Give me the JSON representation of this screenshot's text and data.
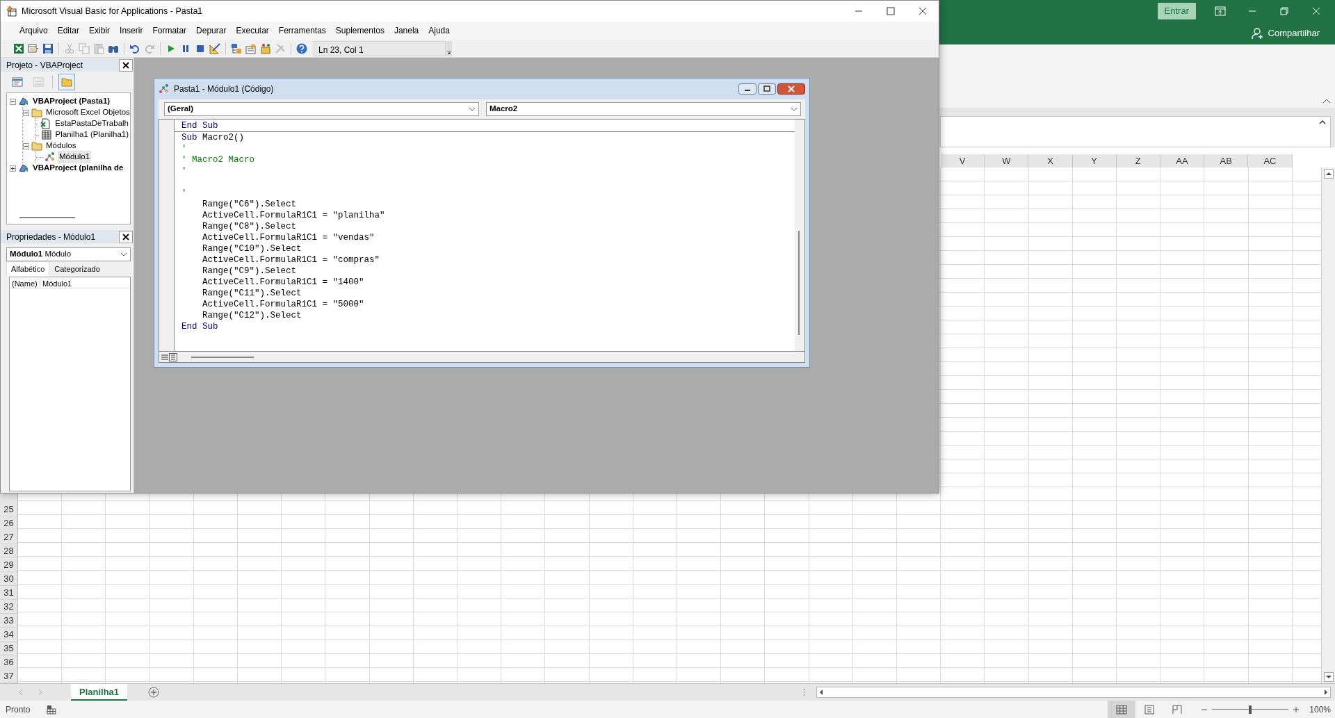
{
  "excel": {
    "sign_in_button": "Entrar",
    "share_button": "Compartilhar",
    "column_headers": [
      "V",
      "W",
      "X",
      "Y",
      "Z",
      "AA",
      "AB",
      "AC"
    ],
    "row_headers": [
      "25",
      "26",
      "27",
      "28",
      "29",
      "30",
      "31",
      "32",
      "33",
      "34",
      "35",
      "36",
      "37"
    ],
    "sheet_tabs": [
      {
        "label": "Planilha1",
        "selected": true
      }
    ],
    "status_bar": {
      "status": "Pronto",
      "views": [
        {
          "kind": "normal",
          "selected": true
        },
        {
          "kind": "page-layout",
          "selected": false
        },
        {
          "kind": "page-break",
          "selected": false
        }
      ],
      "zoom": {
        "level": 0.5,
        "reading": "100%"
      }
    }
  },
  "vba": {
    "title": "Microsoft Visual Basic for Applications - Pasta1",
    "menu": [
      "Arquivo",
      "Editar",
      "Exibir",
      "Inserir",
      "Formatar",
      "Depurar",
      "Executar",
      "Ferramentas",
      "Suplementos",
      "Janela",
      "Ajuda"
    ],
    "toolbar": {
      "buttons": [
        {
          "kind": "excel",
          "disabled": false
        },
        {
          "kind": "insert",
          "disabled": false
        },
        {
          "kind": "save",
          "disabled": false
        },
        {
          "kind": "sep",
          "disabled": false
        },
        {
          "kind": "cut",
          "disabled": true
        },
        {
          "kind": "copy",
          "disabled": true
        },
        {
          "kind": "paste",
          "disabled": true
        },
        {
          "kind": "find",
          "disabled": false
        },
        {
          "kind": "sep",
          "disabled": false
        },
        {
          "kind": "undo",
          "disabled": false
        },
        {
          "kind": "redo",
          "disabled": true
        },
        {
          "kind": "sep",
          "disabled": false
        },
        {
          "kind": "run",
          "disabled": false
        },
        {
          "kind": "pause",
          "disabled": false
        },
        {
          "kind": "stop",
          "disabled": false
        },
        {
          "kind": "design",
          "disabled": false
        },
        {
          "kind": "sep",
          "disabled": false
        },
        {
          "kind": "explorer",
          "disabled": false
        },
        {
          "kind": "properties",
          "disabled": false
        },
        {
          "kind": "browser",
          "disabled": false
        },
        {
          "kind": "toolbox",
          "disabled": true
        },
        {
          "kind": "sep",
          "disabled": false
        },
        {
          "kind": "help",
          "disabled": false
        }
      ],
      "position": "Ln 23, Col 1"
    },
    "project": {
      "title": "Projeto - VBAProject",
      "toolbar": [
        {
          "kind": "view-code",
          "disabled": false,
          "pressed": false
        },
        {
          "kind": "view-object",
          "disabled": true,
          "pressed": false
        },
        {
          "kind": "toggle-folders",
          "disabled": false,
          "pressed": true
        }
      ],
      "tree": [
        {
          "kind": "project",
          "label": "VBAProject (Pasta1)",
          "expanded": true,
          "selected": false,
          "children": [
            {
              "kind": "folder",
              "label": "Microsoft Excel Objetos",
              "expanded": true,
              "selected": false,
              "children": [
                {
                  "kind": "workbook",
                  "label": "EstaPastaDeTrabalh",
                  "selected": false
                },
                {
                  "kind": "sheet",
                  "label": "Planilha1 (Planilha1)",
                  "selected": false
                }
              ]
            },
            {
              "kind": "folder",
              "label": "Módulos",
              "expanded": true,
              "selected": false,
              "children": [
                {
                  "kind": "module",
                  "label": "Módulo1",
                  "selected": true
                }
              ]
            }
          ]
        },
        {
          "kind": "project",
          "label": "VBAProject (planilha de",
          "expanded": false,
          "selected": false
        }
      ]
    },
    "properties": {
      "title": "Propriedades - Módulo1",
      "object": {
        "name": "Módulo1",
        "type": "Módulo"
      },
      "tabs": [
        {
          "label": "Alfabético",
          "selected": true
        },
        {
          "label": "Categorizado",
          "selected": false
        }
      ],
      "rows": [
        {
          "name": "(Name)",
          "value": "Módulo1"
        }
      ]
    },
    "code_window": {
      "title": "Pasta1 - Módulo1 (Código)",
      "object_dropdown": "(Geral)",
      "procedure_dropdown": "Macro2",
      "procedures": [
        {
          "lines": [
            {
              "kind": "code",
              "segments": [
                {
                  "kind": "keyword",
                  "text": "End Sub"
                }
              ]
            }
          ]
        },
        {
          "lines": [
            {
              "kind": "code",
              "segments": [
                {
                  "kind": "keyword",
                  "text": "Sub"
                },
                {
                  "kind": "plain",
                  "text": " Macro2()"
                }
              ]
            },
            {
              "kind": "code",
              "segments": [
                {
                  "kind": "comment",
                  "text": "'"
                }
              ]
            },
            {
              "kind": "code",
              "segments": [
                {
                  "kind": "comment",
                  "text": "' Macro2 Macro"
                }
              ]
            },
            {
              "kind": "code",
              "segments": [
                {
                  "kind": "comment",
                  "text": "'"
                }
              ]
            },
            {
              "kind": "blank"
            },
            {
              "kind": "code",
              "segments": [
                {
                  "kind": "comment",
                  "text": "'"
                }
              ]
            },
            {
              "kind": "code",
              "segments": [
                {
                  "kind": "plain",
                  "text": "    Range(\"C6\").Select"
                }
              ]
            },
            {
              "kind": "code",
              "segments": [
                {
                  "kind": "plain",
                  "text": "    ActiveCell.FormulaR1C1 = \"planilha\""
                }
              ]
            },
            {
              "kind": "code",
              "segments": [
                {
                  "kind": "plain",
                  "text": "    Range(\"C8\").Select"
                }
              ]
            },
            {
              "kind": "code",
              "segments": [
                {
                  "kind": "plain",
                  "text": "    ActiveCell.FormulaR1C1 = \"vendas\""
                }
              ]
            },
            {
              "kind": "code",
              "segments": [
                {
                  "kind": "plain",
                  "text": "    Range(\"C10\").Select"
                }
              ]
            },
            {
              "kind": "code",
              "segments": [
                {
                  "kind": "plain",
                  "text": "    ActiveCell.FormulaR1C1 = \"compras\""
                }
              ]
            },
            {
              "kind": "code",
              "segments": [
                {
                  "kind": "plain",
                  "text": "    Range(\"C9\").Select"
                }
              ]
            },
            {
              "kind": "code",
              "segments": [
                {
                  "kind": "plain",
                  "text": "    ActiveCell.FormulaR1C1 = \"1400\""
                }
              ]
            },
            {
              "kind": "code",
              "segments": [
                {
                  "kind": "plain",
                  "text": "    Range(\"C11\").Select"
                }
              ]
            },
            {
              "kind": "code",
              "segments": [
                {
                  "kind": "plain",
                  "text": "    ActiveCell.FormulaR1C1 = \"5000\""
                }
              ]
            },
            {
              "kind": "code",
              "segments": [
                {
                  "kind": "plain",
                  "text": "    Range(\"C12\").Select"
                }
              ]
            },
            {
              "kind": "code",
              "segments": [
                {
                  "kind": "keyword",
                  "text": "End Sub"
                }
              ]
            }
          ]
        }
      ]
    }
  }
}
